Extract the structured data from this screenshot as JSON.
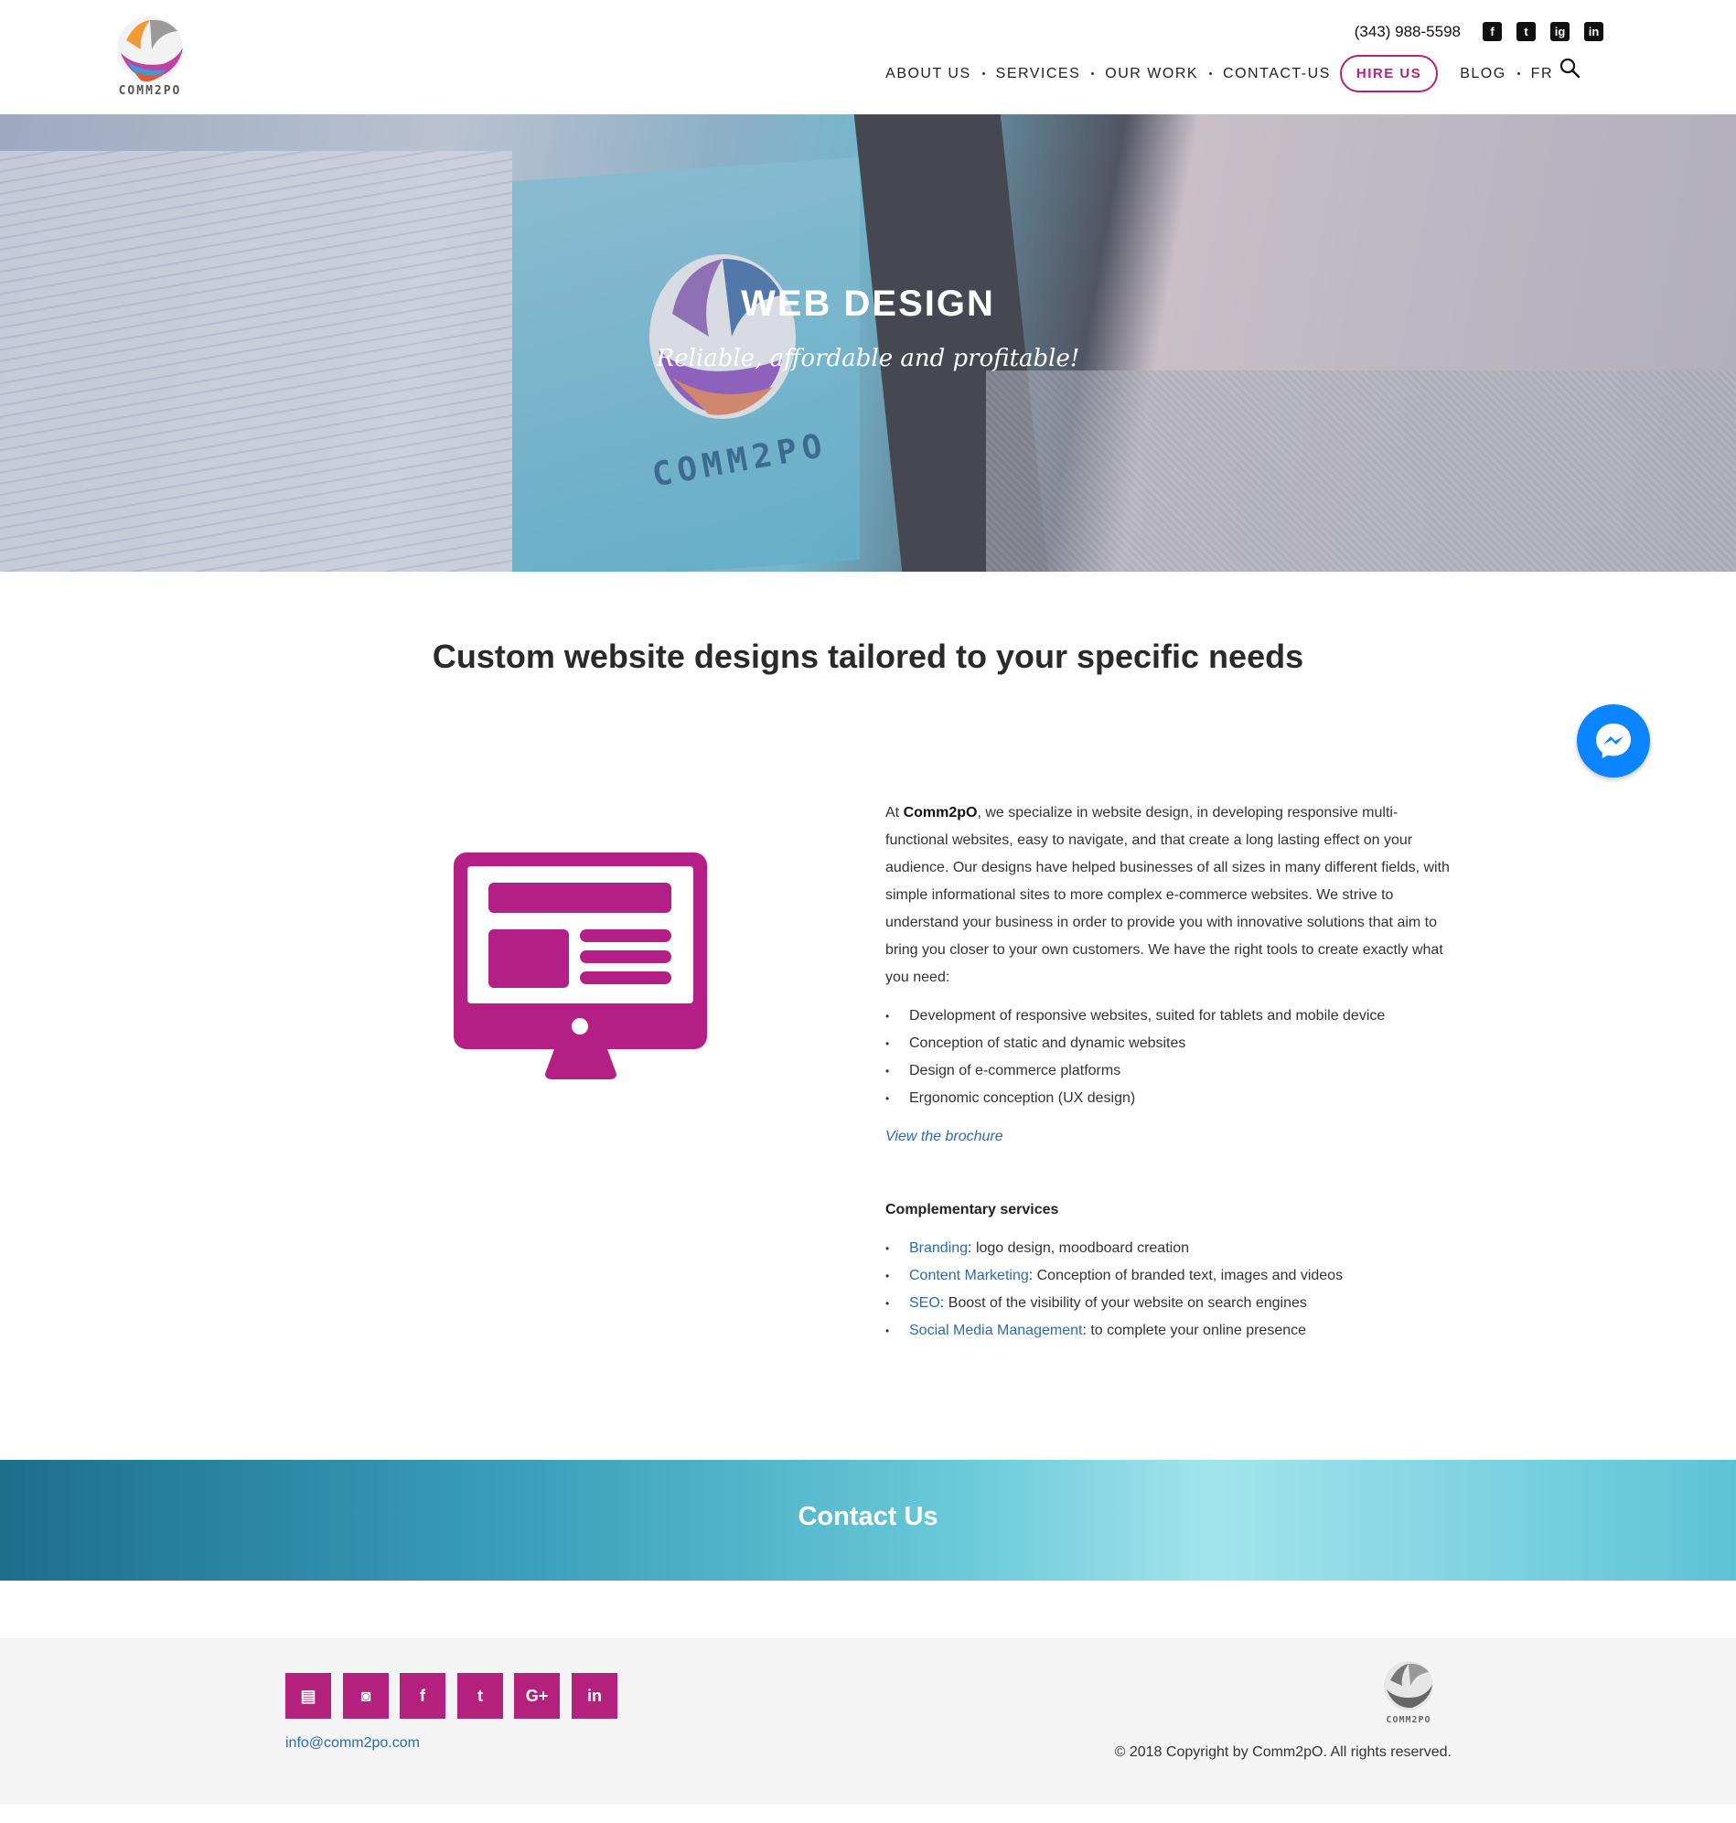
{
  "header": {
    "logo_text": "COMM2PO",
    "phone": "(343) 988-5598",
    "social": [
      "f",
      "t",
      "ig",
      "in"
    ],
    "nav": [
      {
        "label": "ABOUT US",
        "dot": true
      },
      {
        "label": "SERVICES",
        "dot": true
      },
      {
        "label": "OUR WORK",
        "dot": true
      },
      {
        "label": "CONTACT-US",
        "dot": false
      }
    ],
    "hire_label": "HIRE US",
    "nav_after": [
      {
        "label": "BLOG",
        "dot": true
      },
      {
        "label": "FR",
        "dot": false
      }
    ]
  },
  "hero": {
    "title": "WEB DESIGN",
    "subtitle": "Reliable, affordable and profitable!",
    "screen_brand": "COMM2PO"
  },
  "main": {
    "heading": "Custom website designs tailored to your specific needs",
    "intro_prefix": "At ",
    "brand": "Comm2pO",
    "intro_rest": ", we specialize in website design, in developing responsive multi-functional websites, easy to navigate, and that create a long lasting effect on your audience. Our designs have helped businesses of all sizes in many different fields, with simple informational sites to more complex e-commerce websites. We strive to understand your business in order to provide you with innovative solutions that aim to bring you closer to your own customers. We have the right tools to create exactly what you need:",
    "features": [
      "Development of responsive websites, suited for tablets and mobile device",
      "Conception of static and dynamic websites",
      "Design of e-commerce platforms",
      "Ergonomic conception (UX design)"
    ],
    "brochure": "View the brochure",
    "complementary_title": "Complementary services",
    "complementary": [
      {
        "link": "Branding",
        "text": ": logo design, moodboard creation"
      },
      {
        "link": "Content Marketing",
        "text": ": Conception of branded text, images and videos"
      },
      {
        "link": "SEO",
        "text": ": Boost of the visibility of your website on search engines"
      },
      {
        "link": "Social Media Management",
        "text": ": to complete your online presence"
      }
    ]
  },
  "contact": {
    "title": "Contact Us"
  },
  "footer": {
    "social": [
      "▤",
      "◙",
      "f",
      "t",
      "G+",
      "in"
    ],
    "email": "info@comm2po.com",
    "logo_text": "COMM2PO",
    "copyright": "© 2018 Copyright by Comm2pO. All rights reserved."
  },
  "colors": {
    "accent": "#b4217c",
    "link": "#2b6cb0",
    "messenger": "#0a84ff"
  }
}
